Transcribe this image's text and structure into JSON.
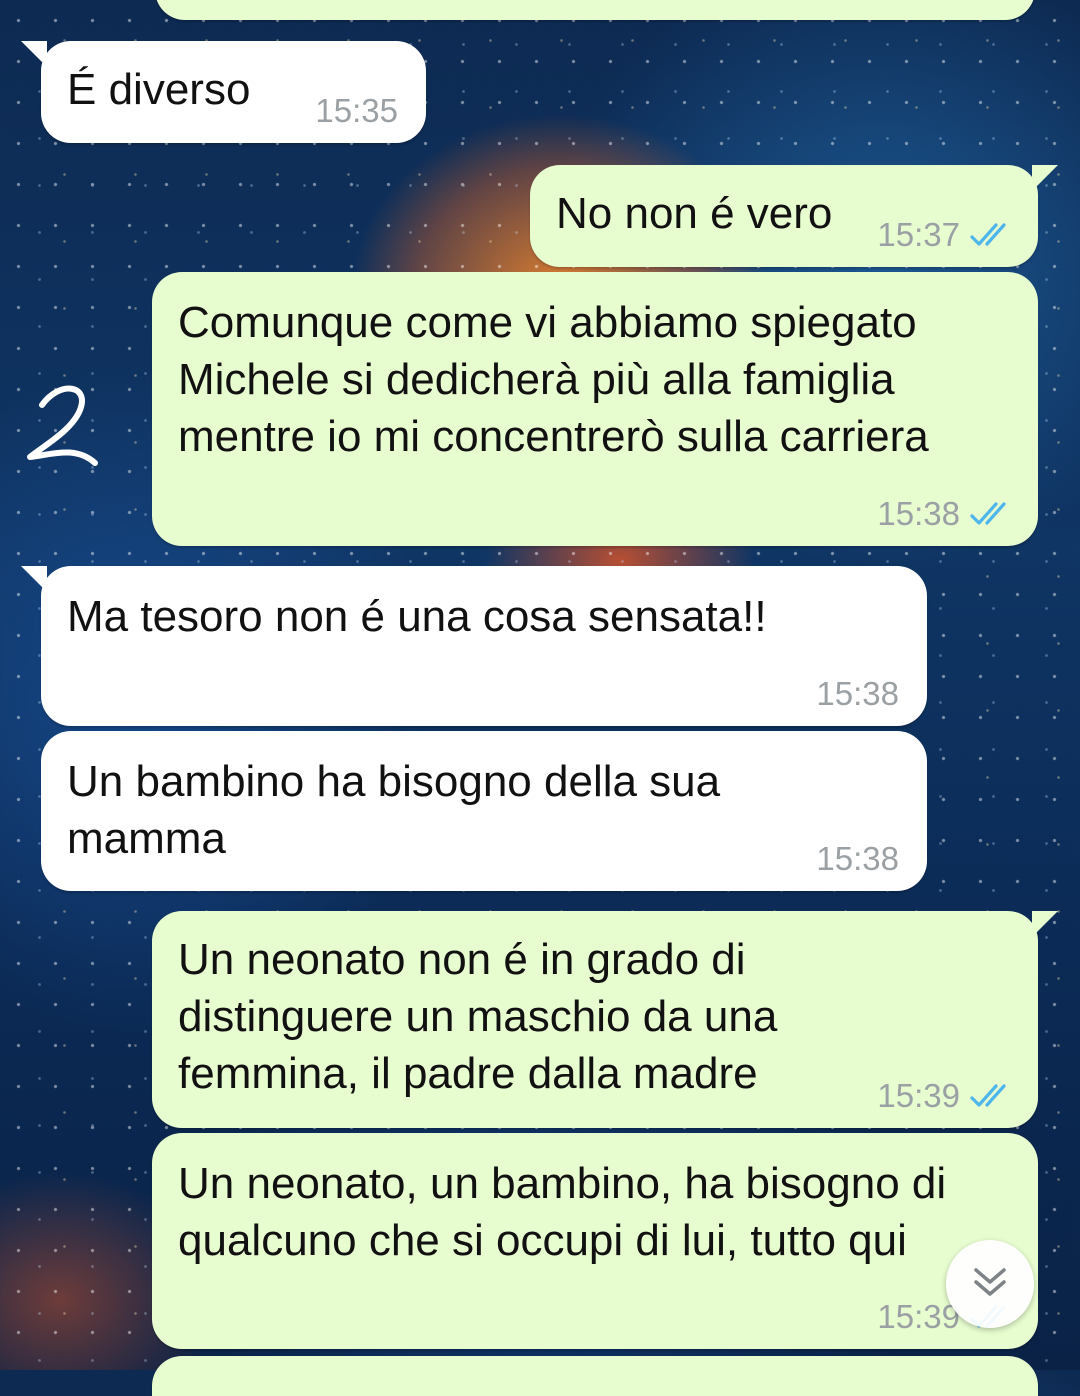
{
  "messages": [
    {
      "dir": "out",
      "text": "",
      "time": ""
    },
    {
      "dir": "in",
      "text": "É diverso",
      "time": "15:35"
    },
    {
      "dir": "out",
      "text": "No non é vero",
      "time": "15:37"
    },
    {
      "dir": "out",
      "text": "Comunque come vi abbiamo spiegato\nMichele si dedicherà più alla famiglia\nmentre io mi concentrerò sulla carriera",
      "time": "15:38"
    },
    {
      "dir": "in",
      "text": "Ma tesoro non é una cosa sensata!!",
      "time": "15:38"
    },
    {
      "dir": "in",
      "text": "Un bambino ha bisogno della sua\nmamma",
      "time": "15:38"
    },
    {
      "dir": "out",
      "text": "Un neonato non é in grado di\ndistinguere un maschio da una\nfemmina, il padre dalla madre",
      "time": "15:39"
    },
    {
      "dir": "out",
      "text": "Un neonato, un bambino, ha bisogno di\nqualcuno che si occupi di lui, tutto qui",
      "time": "15:39"
    },
    {
      "dir": "out",
      "text": "",
      "time": ""
    }
  ],
  "colors": {
    "incoming_bubble": "#ffffff",
    "outgoing_bubble": "#e7fccf",
    "read_tick": "#4fb6ec",
    "timestamp": "#9aa0a3"
  },
  "icons": {
    "read_receipt": "double-check-icon",
    "scroll_down": "double-chevron-down-icon",
    "annotation": "handwritten-scribble"
  }
}
